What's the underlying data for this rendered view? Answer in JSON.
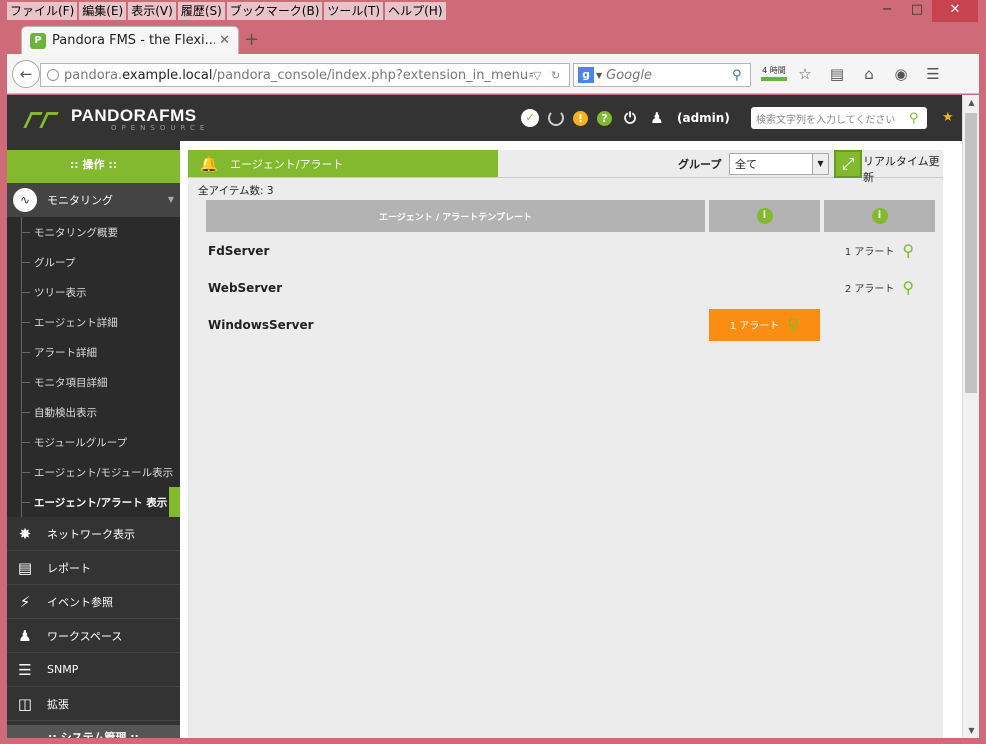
{
  "browser": {
    "menu": [
      "ファイル(F)",
      "編集(E)",
      "表示(V)",
      "履歴(S)",
      "ブックマーク(B)",
      "ツール(T)",
      "ヘルプ(H)"
    ],
    "window_controls": [
      "−",
      "□",
      "✕"
    ],
    "tab_title": "Pandora FMS - the Flexi...",
    "tab_close": "✕",
    "new_tab": "+",
    "url_host": "pandora.",
    "url_domain": "example.local",
    "url_path": "/pandora_console/index.php?extension_in_menu=estac",
    "search_placeholder": "Google",
    "news_badge": "4 時間"
  },
  "header": {
    "logo_text": "PANDORAFMS",
    "logo_sub": "OPENSOURCE",
    "user": "(admin)",
    "search_placeholder": "検索文字列を入力してください"
  },
  "sidebar": {
    "operation_title": ":: 操作 ::",
    "monitoring": "モニタリング",
    "monitoring_items": [
      "モニタリング概要",
      "グループ",
      "ツリー表示",
      "エージェント詳細",
      "アラート詳細",
      "モニタ項目詳細",
      "自動検出表示",
      "モジュールグループ",
      "エージェント/モジュール表示",
      "エージェント/アラート 表示"
    ],
    "menus": [
      "ネットワーク表示",
      "レポート",
      "イベント参照",
      "ワークスペース",
      "SNMP",
      "拡張"
    ],
    "admin_title": ":: システム管理 ::"
  },
  "content": {
    "tab_title": "エージェント/アラート",
    "group_label": "グループ",
    "group_value": "全て",
    "realtime_label": "リアルタイム更新",
    "total_label": "全アイテム数: 3",
    "columns": [
      "エージェント / アラートテンプレート",
      "i",
      "i"
    ],
    "rows": [
      {
        "agent": "FdServer",
        "col2": "",
        "col3": "1 アラート"
      },
      {
        "agent": "WebServer",
        "col2": "",
        "col3": "2 アラート"
      },
      {
        "agent": "WindowsServer",
        "col2": "1 アラート",
        "col3": ""
      }
    ]
  },
  "colors": {
    "accent_green": "#82b92e",
    "alert_orange": "#fa8d12",
    "header_dark": "#333333"
  }
}
